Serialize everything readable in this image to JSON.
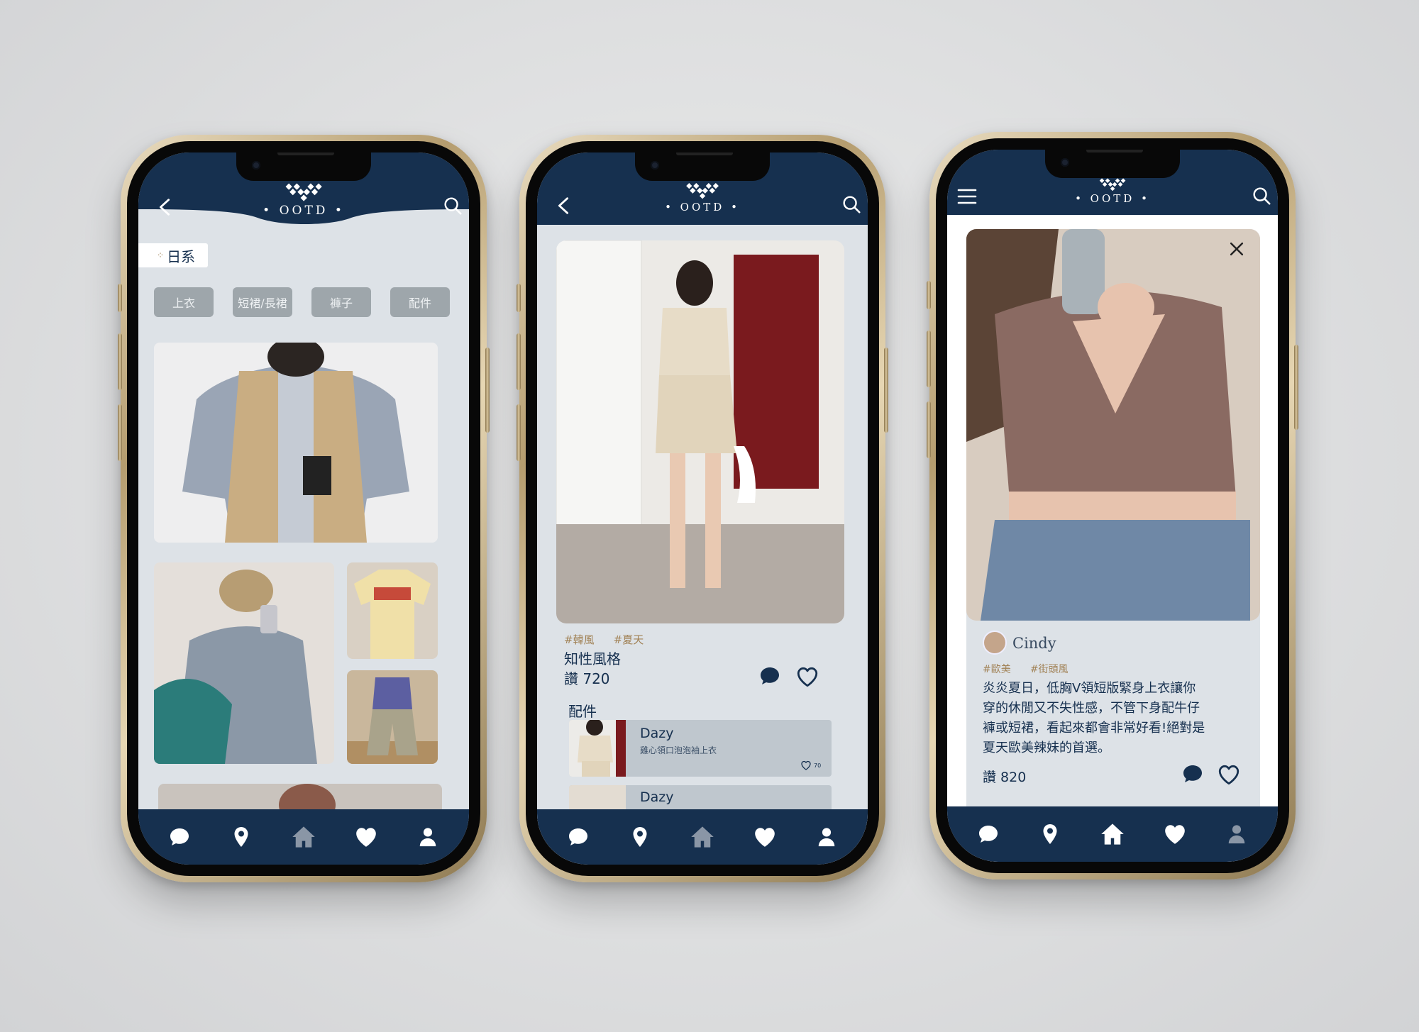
{
  "brand": {
    "logo_text": "• OOTD •"
  },
  "screen1": {
    "category_title": "日系",
    "filters": [
      "上衣",
      "短裙/長裙",
      "褲子",
      "配件"
    ]
  },
  "screen2": {
    "tags": [
      "#韓風",
      "#夏天"
    ],
    "title": "知性風格",
    "likes_label": "讚 720",
    "section_label": "配件",
    "products": [
      {
        "brand": "Dazy",
        "desc": "雞心領口泡泡袖上衣",
        "likes": "70"
      },
      {
        "brand": "Dazy"
      }
    ]
  },
  "screen3": {
    "user_name": "Cindy",
    "tags": [
      "#歐美",
      "#街頭風"
    ],
    "caption_lines": [
      "炎炎夏日，低胸V領短版緊身上衣讓你",
      "穿的休閒又不失性感，不管下身配牛仔",
      "褲或短裙，看起來都會非常好看!絕對是",
      "夏天歐美辣妹的首選。"
    ],
    "likes_label": "讚 820"
  },
  "icons": {
    "back": "back-arrow-icon",
    "search": "search-icon",
    "menu": "hamburger-menu-icon",
    "close": "close-icon",
    "tabs": [
      "chat-icon",
      "location-pin-icon",
      "home-icon",
      "heart-icon",
      "user-icon"
    ]
  },
  "colors": {
    "navy": "#16304f",
    "card_bg": "#dde2e7",
    "chip_bg": "#9ea6ab",
    "tag_gold": "#a18256"
  }
}
